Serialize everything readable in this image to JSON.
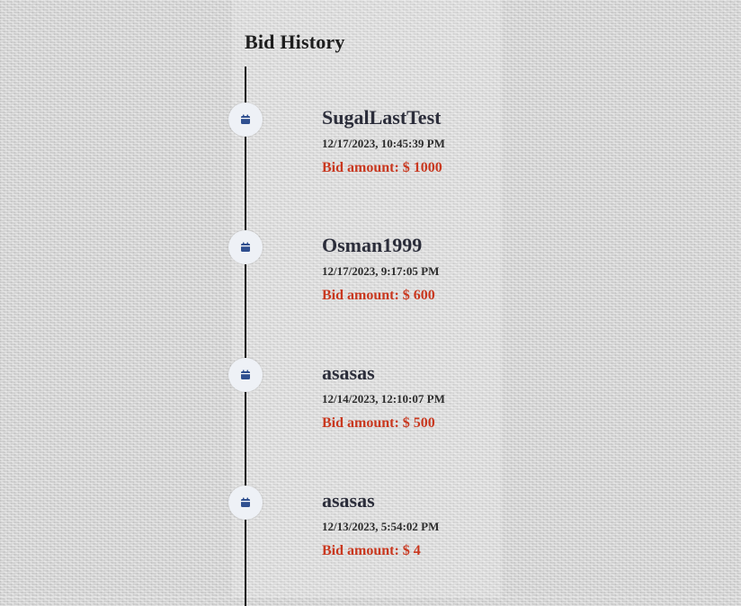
{
  "title": "Bid History",
  "icon": "calendar-icon",
  "colors": {
    "accent": "#2f4f8f",
    "amount": "#c9381f",
    "timeline_line": "#111111"
  },
  "bids": [
    {
      "name": "SugalLastTest",
      "time": "12/17/2023, 10:45:39 PM",
      "amount": "Bid amount: $ 1000"
    },
    {
      "name": "Osman1999",
      "time": "12/17/2023, 9:17:05 PM",
      "amount": "Bid amount: $ 600"
    },
    {
      "name": "asasas",
      "time": "12/14/2023, 12:10:07 PM",
      "amount": "Bid amount: $ 500"
    },
    {
      "name": "asasas",
      "time": "12/13/2023, 5:54:02 PM",
      "amount": "Bid amount: $ 4"
    }
  ]
}
